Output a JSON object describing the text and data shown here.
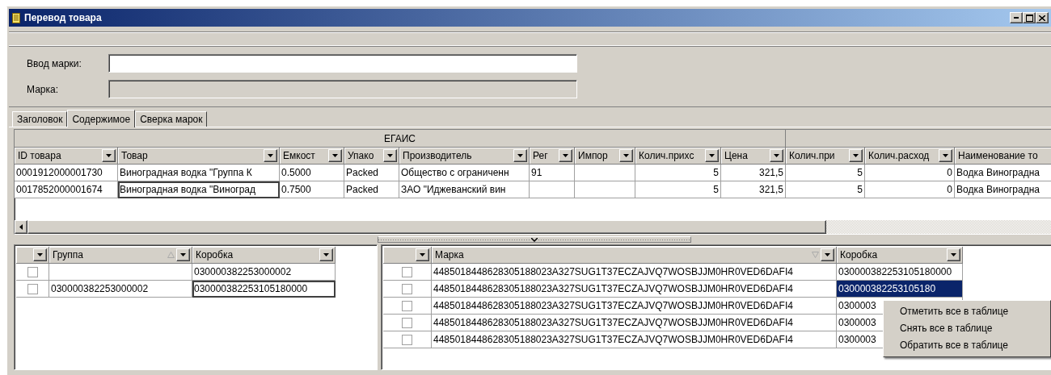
{
  "window": {
    "title": "Перевод товара"
  },
  "form": {
    "fields": [
      {
        "label": "Ввод марки:",
        "disabled": false
      },
      {
        "label": "Марка:",
        "disabled": true
      }
    ]
  },
  "tabs": [
    {
      "label": "Заголовок",
      "selected": false
    },
    {
      "label": "Содержимое",
      "selected": true
    },
    {
      "label": "Сверка марок",
      "selected": false
    }
  ],
  "top_table": {
    "groups": [
      {
        "label": "ЕГАИС",
        "columns": [
          "ID товара",
          "Товар",
          "Емкост",
          "Упако",
          "Производитель",
          "Рег",
          "Импор",
          "Колич.прихс",
          "Цена"
        ]
      },
      {
        "columns": [
          "Колич.при",
          "Колич.расход",
          "Наименование то"
        ]
      }
    ],
    "rows": [
      {
        "cells": [
          "0001912000001730",
          "Виноградная водка \"Группа К",
          "0.5000",
          "Packed",
          "Общество с ограниченн",
          "91",
          null,
          "5",
          "321,5",
          "5",
          "0",
          "Водка Виноградна"
        ]
      },
      {
        "cells": [
          "0017852000001674",
          {
            "text": "Виноградная водка \"Виноград",
            "focused": true
          },
          "0.7500",
          "Packed",
          "ЗАО \"Иджеванский вин",
          null,
          null,
          "5",
          "321,5",
          "5",
          "0",
          "Водка Виноградна"
        ]
      }
    ]
  },
  "left_table": {
    "columns": [
      {
        "label": "Группа",
        "sorted": true,
        "descending": false
      },
      {
        "label": "Коробка",
        "sorted": false
      }
    ],
    "rows": [
      {
        "checked": false,
        "cells": [
          null,
          "030000382253000002"
        ]
      },
      {
        "checked": false,
        "cells": [
          "030000382253000002",
          {
            "text": "030000382253105180000",
            "focused": true
          }
        ]
      }
    ]
  },
  "right_table": {
    "columns": [
      {
        "label": "Марка",
        "sorted": true,
        "descending": true
      },
      {
        "label": "Коробка",
        "sorted": false
      }
    ],
    "rows": [
      {
        "checked": false,
        "cells": [
          "4485018448628305188023A327SUG1T37ECZAJVQ7WOSBJJM0HR0VED6DAFI4",
          "030000382253105180000"
        ]
      },
      {
        "checked": false,
        "cells": [
          "4485018448628305188023A327SUG1T37ECZAJVQ7WOSBJJM0HR0VED6DAFI4",
          {
            "text": "030000382253105180",
            "selected": true
          }
        ]
      },
      {
        "checked": false,
        "cells": [
          "4485018448628305188023A327SUG1T37ECZAJVQ7WOSBJJM0HR0VED6DAFI4",
          "0300003"
        ]
      },
      {
        "checked": false,
        "cells": [
          "4485018448628305188023A327SUG1T37ECZAJVQ7WOSBJJM0HR0VED6DAFI4",
          "0300003"
        ]
      },
      {
        "checked": false,
        "cells": [
          "4485018448628305188023A327SUG1T37ECZAJVQ7WOSBJJM0HR0VED6DAFI4",
          "0300003"
        ]
      }
    ]
  },
  "context_menu": {
    "items": [
      "Отметить все в таблице",
      "Снять все в таблице",
      "Обратить все в таблице"
    ]
  }
}
